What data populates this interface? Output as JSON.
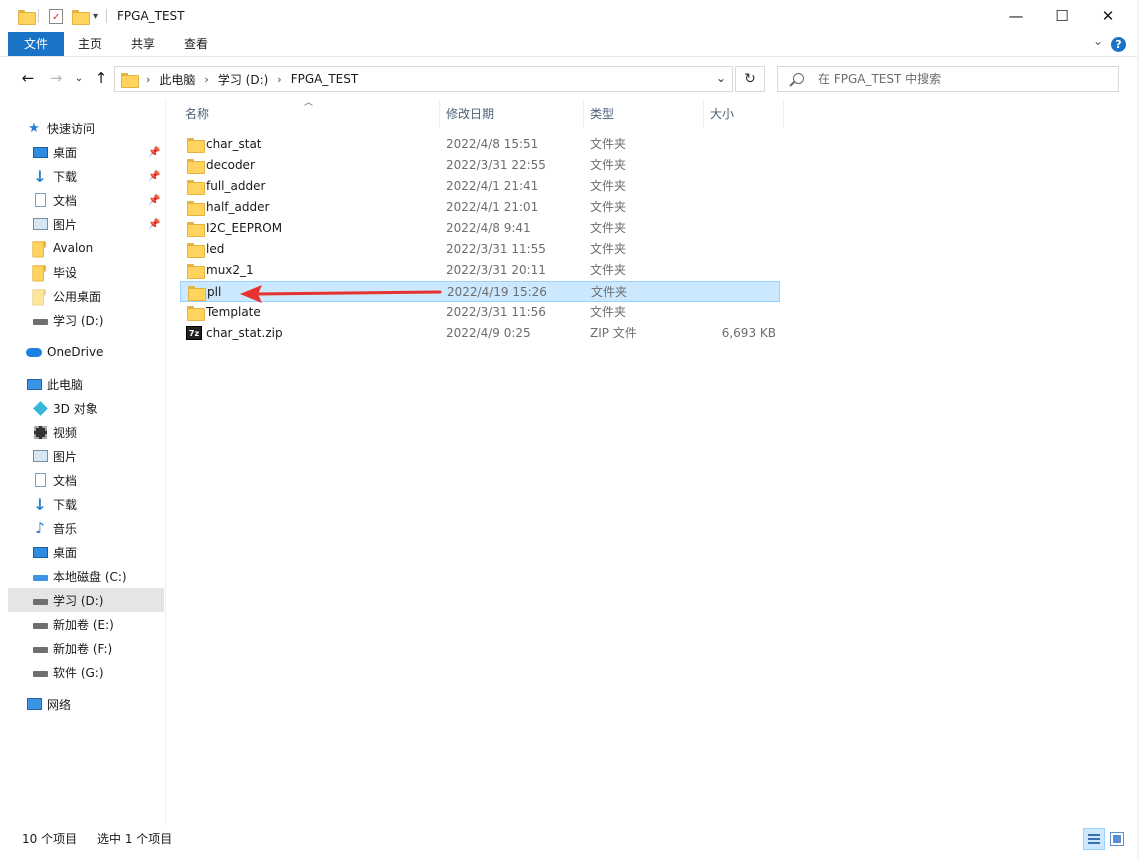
{
  "window": {
    "title": "FPGA_TEST",
    "minimize_glyph": "—",
    "maximize_glyph": "☐",
    "close_glyph": "✕"
  },
  "ribbon": {
    "tabs": [
      "文件",
      "主页",
      "共享",
      "查看"
    ],
    "help_glyph": "?"
  },
  "address": {
    "crumbs": [
      "此电脑",
      "学习 (D:)",
      "FPGA_TEST"
    ],
    "separator": "›"
  },
  "search": {
    "placeholder": "在 FPGA_TEST 中搜索"
  },
  "sidebar": {
    "quick_access": "快速访问",
    "quick_items": [
      "桌面",
      "下载",
      "文档",
      "图片",
      "Avalon",
      "毕设",
      "公用桌面",
      "学习 (D:)"
    ],
    "onedrive": "OneDrive",
    "this_pc": "此电脑",
    "pc_items": [
      "3D 对象",
      "视频",
      "图片",
      "文档",
      "下载",
      "音乐",
      "桌面",
      "本地磁盘 (C:)",
      "学习 (D:)",
      "新加卷 (E:)",
      "新加卷 (F:)",
      "软件 (G:)"
    ],
    "network": "网络"
  },
  "columns": {
    "name": "名称",
    "date": "修改日期",
    "type": "类型",
    "size": "大小"
  },
  "files": [
    {
      "name": "char_stat",
      "date": "2022/4/8 15:51",
      "type": "文件夹",
      "size": ""
    },
    {
      "name": "decoder",
      "date": "2022/3/31 22:55",
      "type": "文件夹",
      "size": ""
    },
    {
      "name": "full_adder",
      "date": "2022/4/1 21:41",
      "type": "文件夹",
      "size": ""
    },
    {
      "name": "half_adder",
      "date": "2022/4/1 21:01",
      "type": "文件夹",
      "size": ""
    },
    {
      "name": "I2C_EEPROM",
      "date": "2022/4/8 9:41",
      "type": "文件夹",
      "size": ""
    },
    {
      "name": "led",
      "date": "2022/3/31 11:55",
      "type": "文件夹",
      "size": ""
    },
    {
      "name": "mux2_1",
      "date": "2022/3/31 20:11",
      "type": "文件夹",
      "size": ""
    },
    {
      "name": "pll",
      "date": "2022/4/19 15:26",
      "type": "文件夹",
      "size": ""
    },
    {
      "name": "Template",
      "date": "2022/3/31 11:56",
      "type": "文件夹",
      "size": ""
    },
    {
      "name": "char_stat.zip",
      "date": "2022/4/9 0:25",
      "type": "ZIP 文件",
      "size": "6,693 KB"
    }
  ],
  "zip_icon_label": "7z",
  "status": {
    "count": "10 个项目",
    "selected": "选中 1 个项目"
  },
  "colors": {
    "accent": "#1a73c6",
    "selection": "#cce8ff",
    "arrow": "#e8322f",
    "folder": "#ffd35c"
  }
}
